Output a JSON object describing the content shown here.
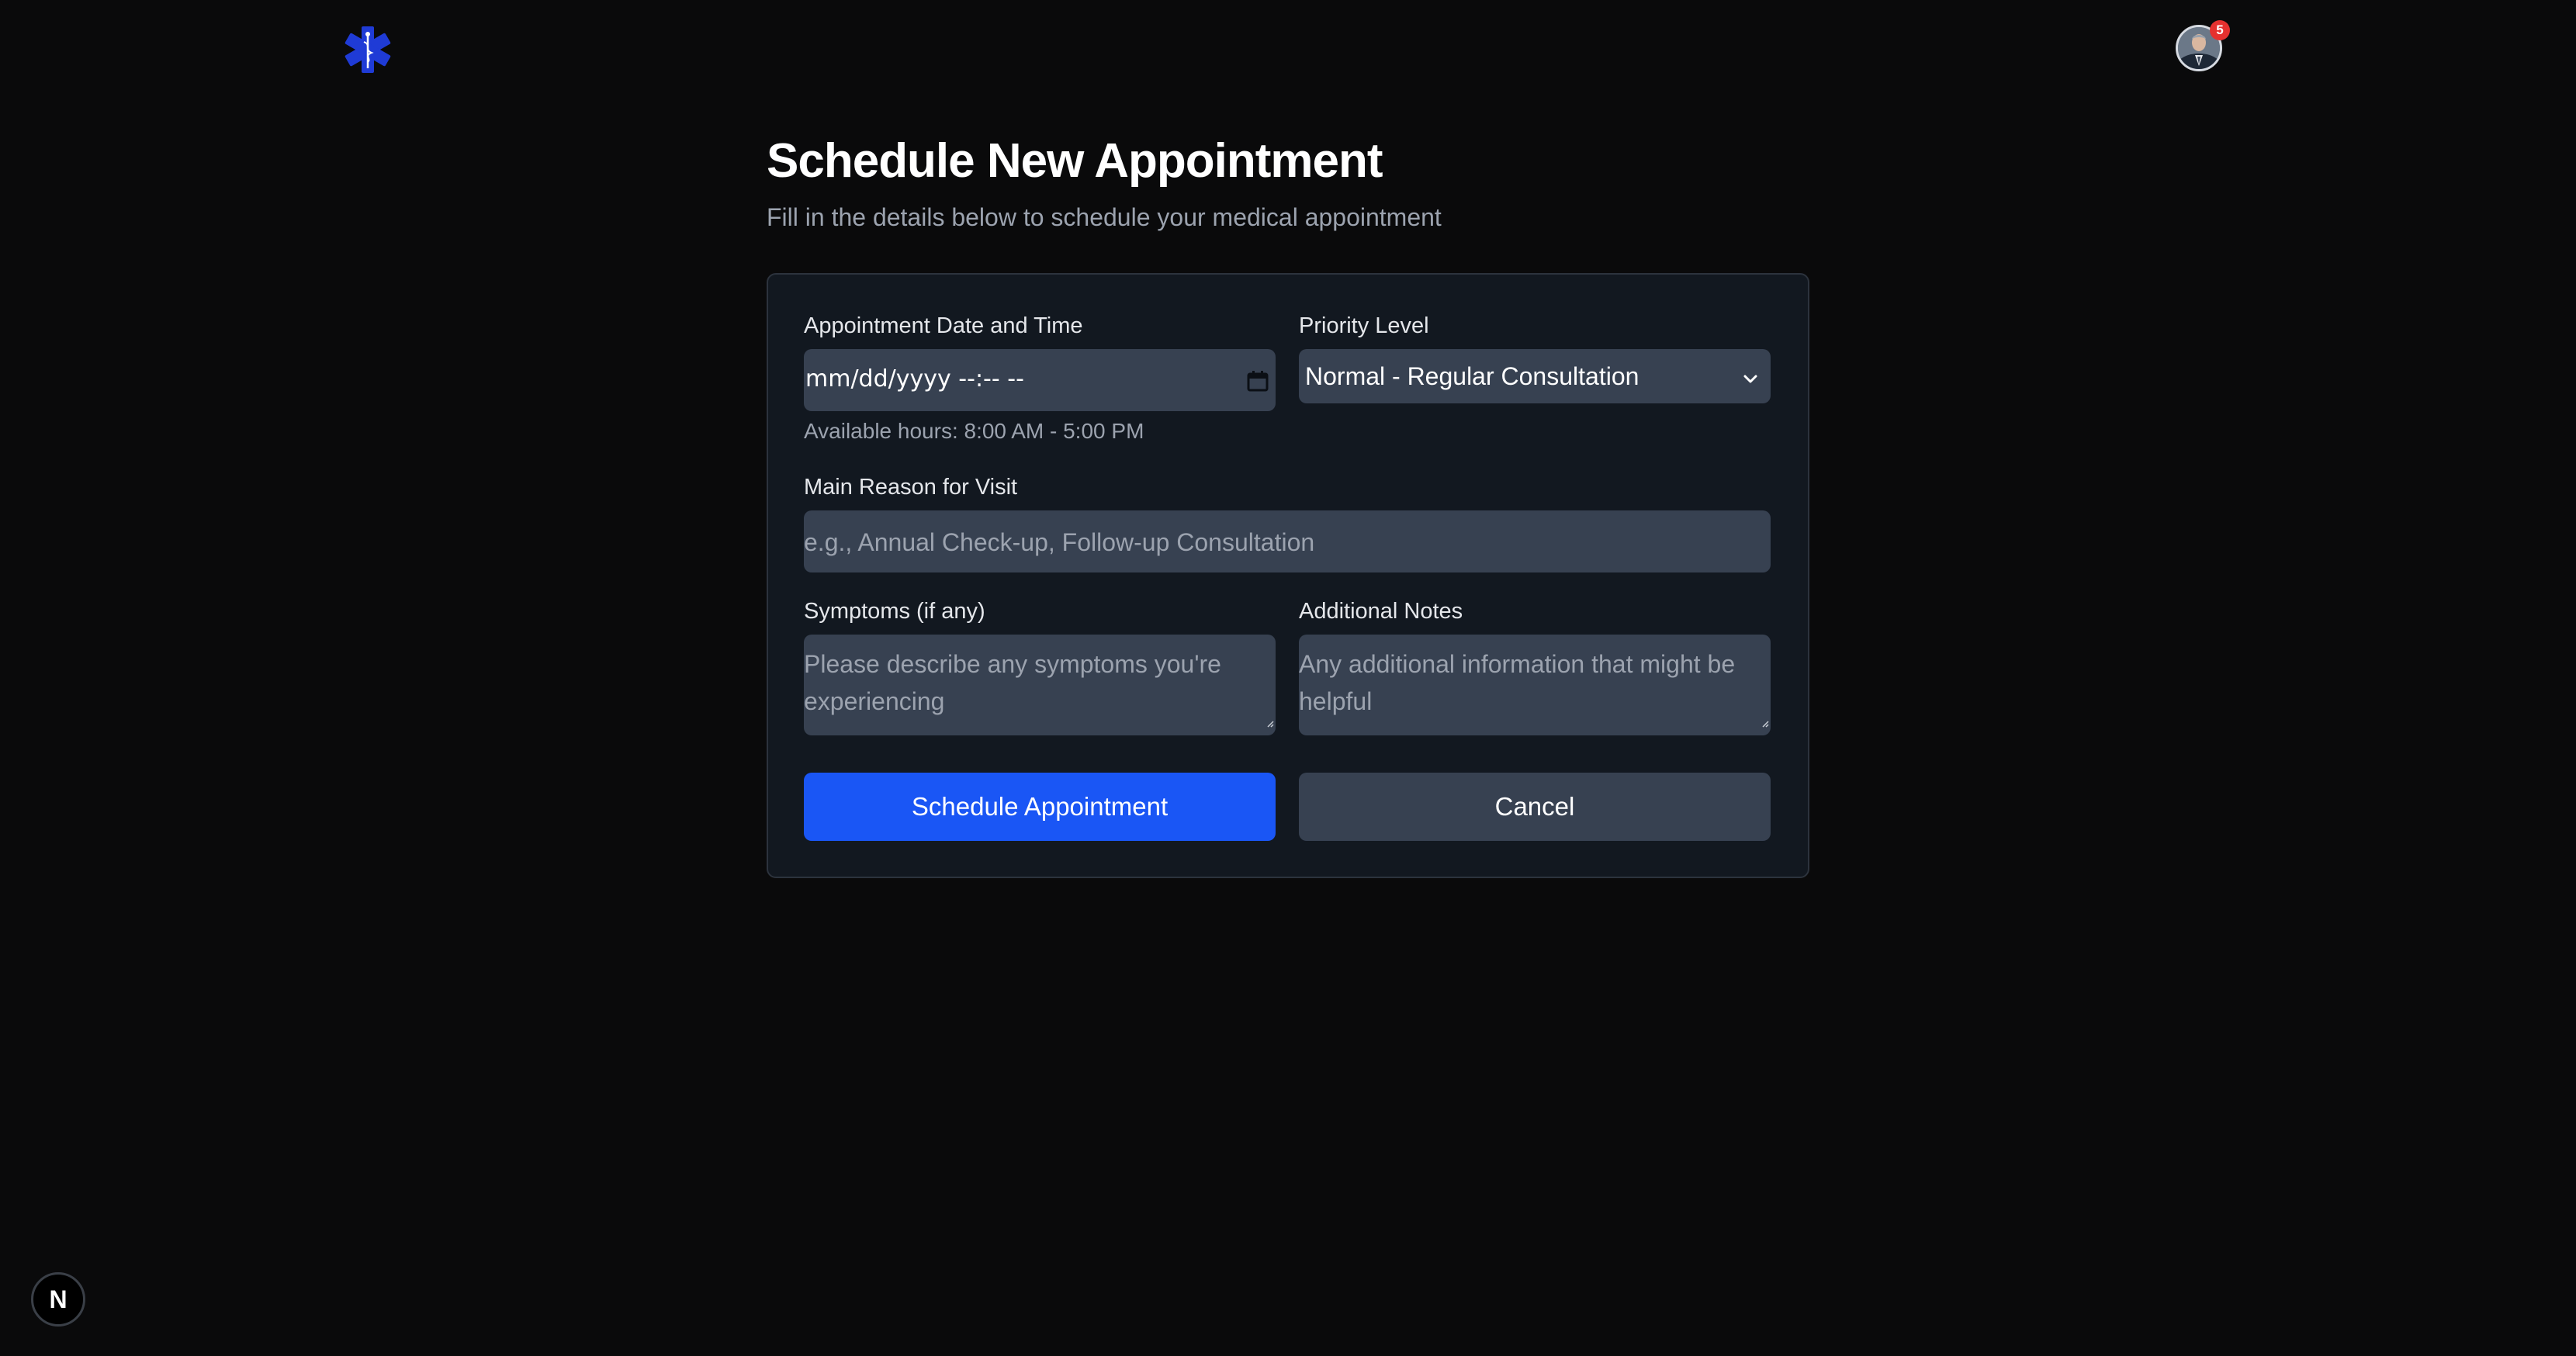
{
  "header": {
    "logo_icon": "star-of-life-icon",
    "avatar_icon": "user-avatar",
    "notification_count": "5"
  },
  "page": {
    "title": "Schedule New Appointment",
    "subtitle": "Fill in the details below to schedule your medical appointment"
  },
  "form": {
    "datetime": {
      "label": "Appointment Date and Time",
      "value": "mm/dd/yyyy --:-- --",
      "hint": "Available hours: 8:00 AM - 5:00 PM",
      "icon": "calendar-icon"
    },
    "priority": {
      "label": "Priority Level",
      "selected": "Normal - Regular Consultation",
      "icon": "chevron-down-icon"
    },
    "reason": {
      "label": "Main Reason for Visit",
      "placeholder": "e.g., Annual Check-up, Follow-up Consultation"
    },
    "symptoms": {
      "label": "Symptoms (if any)",
      "placeholder": "Please describe any symptoms you're experiencing"
    },
    "notes": {
      "label": "Additional Notes",
      "placeholder": "Any additional information that might be helpful"
    },
    "submit_label": "Schedule Appointment",
    "cancel_label": "Cancel"
  },
  "dev_badge": {
    "label": "N"
  },
  "colors": {
    "background": "#0a0a0b",
    "card": "#121820",
    "field": "#374151",
    "primary": "#1a56f5",
    "badge": "#e5312f",
    "logo": "#1f3bd6"
  }
}
